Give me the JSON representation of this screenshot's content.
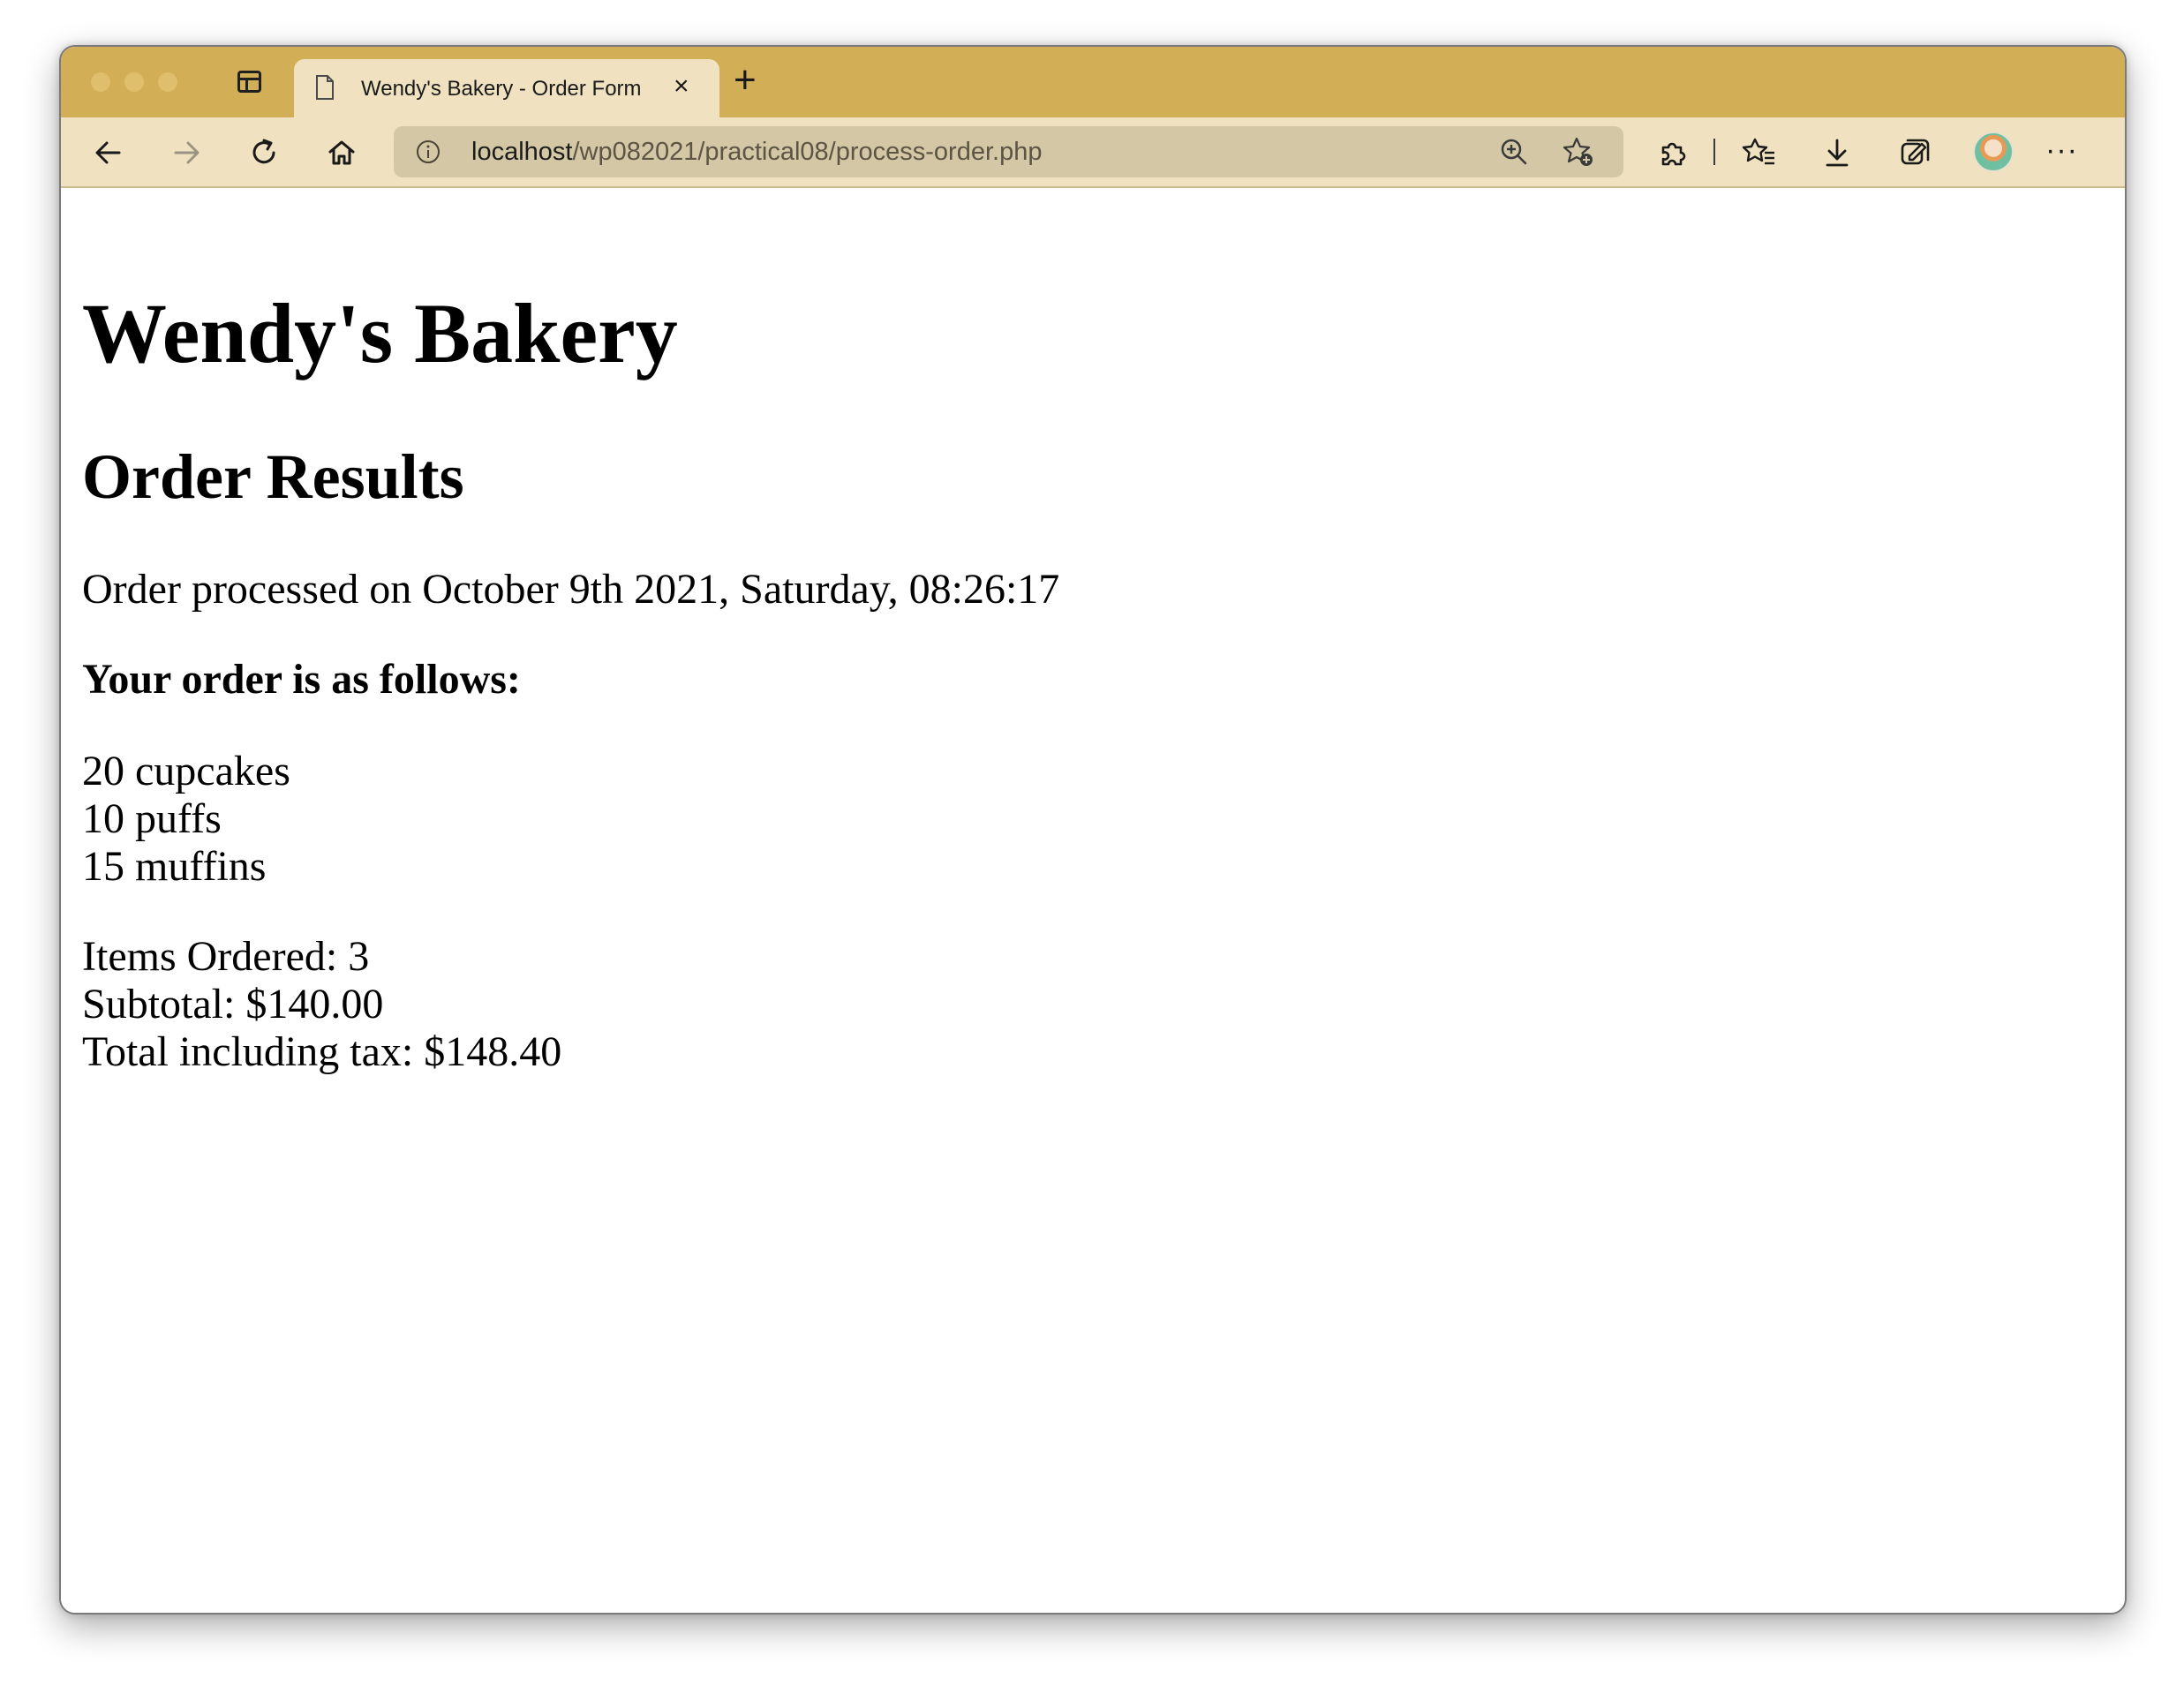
{
  "browser": {
    "tab": {
      "title": "Wendy's Bakery - Order Form",
      "close_glyph": "×"
    },
    "new_tab_glyph": "+",
    "address": {
      "host": "localhost",
      "path": "/wp082021/practical08/process-order.php"
    },
    "more_glyph": "···",
    "icons": {
      "tab_actions": "tab-actions-icon",
      "back": "back-arrow-icon",
      "forward": "forward-arrow-icon",
      "refresh": "refresh-icon",
      "home": "home-icon",
      "info": "info-icon",
      "zoom": "zoom-in-icon",
      "add_favorite": "add-favorite-icon",
      "extensions": "puzzle-icon",
      "favorites": "favorites-icon",
      "downloads": "download-icon",
      "collections": "collections-icon",
      "profile": "avatar"
    },
    "colors": {
      "tabbar": "#d2ae57",
      "toolbar": "#f0e2c0",
      "address_bar": "#d4c7a5"
    }
  },
  "page": {
    "heading": "Wendy's Bakery",
    "subheading": "Order Results",
    "processed_line": "Order processed on October 9th 2021, Saturday, 08:26:17",
    "order_intro": "Your order is as follows:",
    "items": [
      "20 cupcakes",
      "10 puffs",
      "15 muffins"
    ],
    "summary": {
      "items_ordered": "Items Ordered: 3",
      "subtotal": "Subtotal: $140.00",
      "total": "Total including tax: $148.40"
    }
  }
}
